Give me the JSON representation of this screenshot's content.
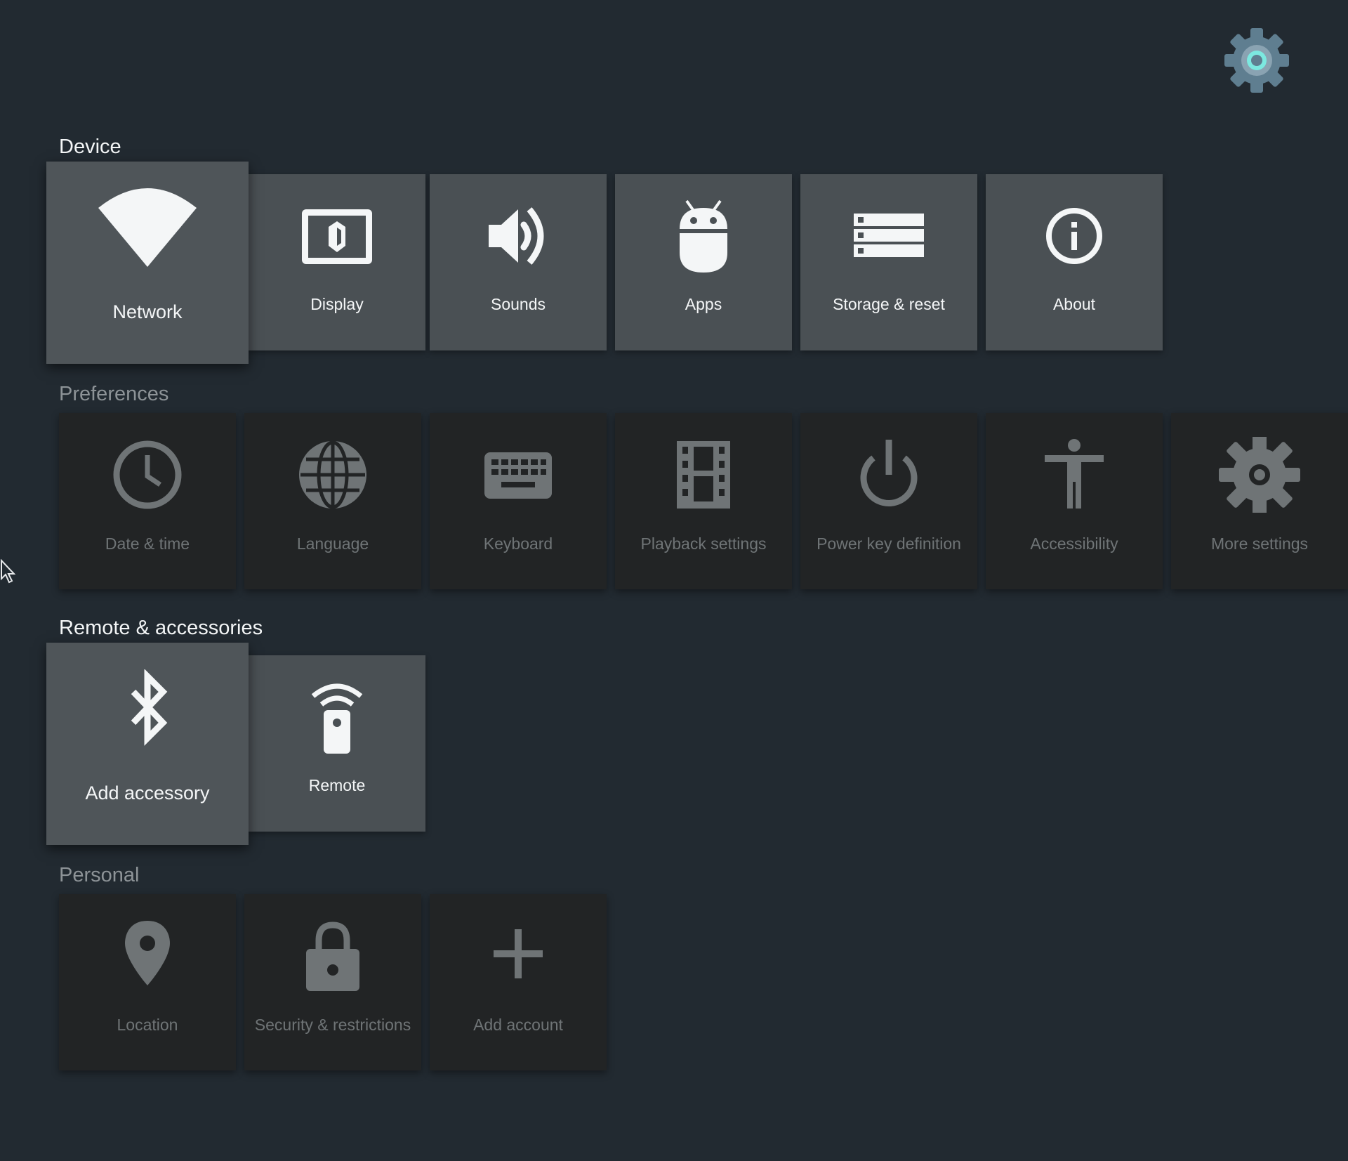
{
  "app": {
    "logo_icon": "settings-gear-icon",
    "accent_color": "#7ce8e0"
  },
  "sections": {
    "device": {
      "title": "Device",
      "items": [
        {
          "label": "Network",
          "icon": "wifi-icon"
        },
        {
          "label": "Display",
          "icon": "display-icon"
        },
        {
          "label": "Sounds",
          "icon": "volume-icon"
        },
        {
          "label": "Apps",
          "icon": "android-icon"
        },
        {
          "label": "Storage & reset",
          "icon": "storage-icon"
        },
        {
          "label": "About",
          "icon": "info-icon"
        }
      ]
    },
    "preferences": {
      "title": "Preferences",
      "items": [
        {
          "label": "Date & time",
          "icon": "clock-icon"
        },
        {
          "label": "Language",
          "icon": "globe-icon"
        },
        {
          "label": "Keyboard",
          "icon": "keyboard-icon"
        },
        {
          "label": "Playback settings",
          "icon": "film-icon"
        },
        {
          "label": "Power key definition",
          "icon": "power-icon"
        },
        {
          "label": "Accessibility",
          "icon": "accessibility-icon"
        },
        {
          "label": "More settings",
          "icon": "gear-icon"
        }
      ]
    },
    "remote": {
      "title": "Remote & accessories",
      "items": [
        {
          "label": "Add accessory",
          "icon": "bluetooth-icon"
        },
        {
          "label": "Remote",
          "icon": "remote-icon"
        }
      ]
    },
    "personal": {
      "title": "Personal",
      "items": [
        {
          "label": "Location",
          "icon": "location-pin-icon"
        },
        {
          "label": "Security & restrictions",
          "icon": "lock-icon"
        },
        {
          "label": "Add account",
          "icon": "plus-icon"
        }
      ]
    }
  }
}
